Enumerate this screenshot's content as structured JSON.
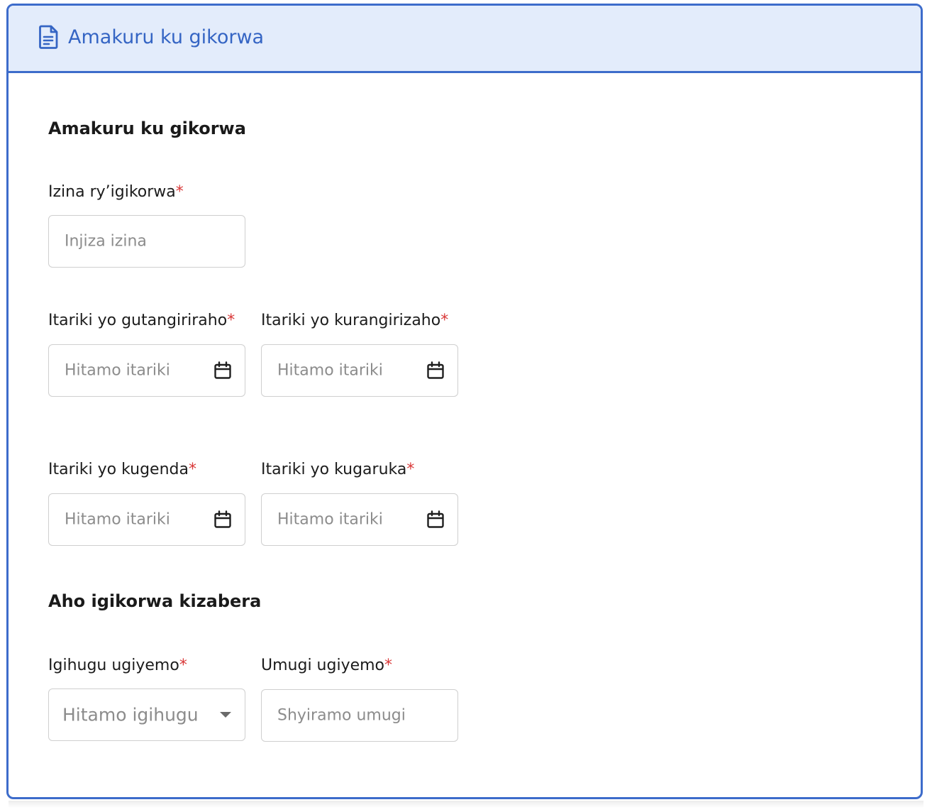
{
  "header": {
    "icon": "document-icon",
    "title": "Amakuru ku gikorwa",
    "accent_color": "#3d6ccb",
    "background_color": "#e3ecfb"
  },
  "section1": {
    "title": "Amakuru ku gikorwa"
  },
  "activity_name": {
    "label": "Izina ry’igikorwa",
    "required_mark": "*",
    "placeholder": "Injiza izina",
    "value": ""
  },
  "start_date": {
    "label": "Itariki yo gutangiriraho",
    "required_mark": "*",
    "placeholder": "Hitamo itariki",
    "icon": "calendar-icon"
  },
  "end_date": {
    "label": "Itariki yo kurangirizaho",
    "required_mark": "*",
    "placeholder": "Hitamo itariki",
    "icon": "calendar-icon"
  },
  "departure_date": {
    "label": "Itariki yo kugenda",
    "required_mark": "*",
    "placeholder": "Hitamo itariki",
    "icon": "calendar-icon"
  },
  "return_date": {
    "label": "Itariki yo kugaruka",
    "required_mark": "*",
    "placeholder": "Hitamo itariki",
    "icon": "calendar-icon"
  },
  "section2": {
    "title": "Aho igikorwa kizabera"
  },
  "country": {
    "label": "Igihugu ugiyemo",
    "required_mark": "*",
    "placeholder": "Hitamo igihugu",
    "icon": "chevron-down-icon"
  },
  "city": {
    "label": "Umugi ugiyemo",
    "required_mark": "*",
    "placeholder": "Shyiramo umugi"
  }
}
